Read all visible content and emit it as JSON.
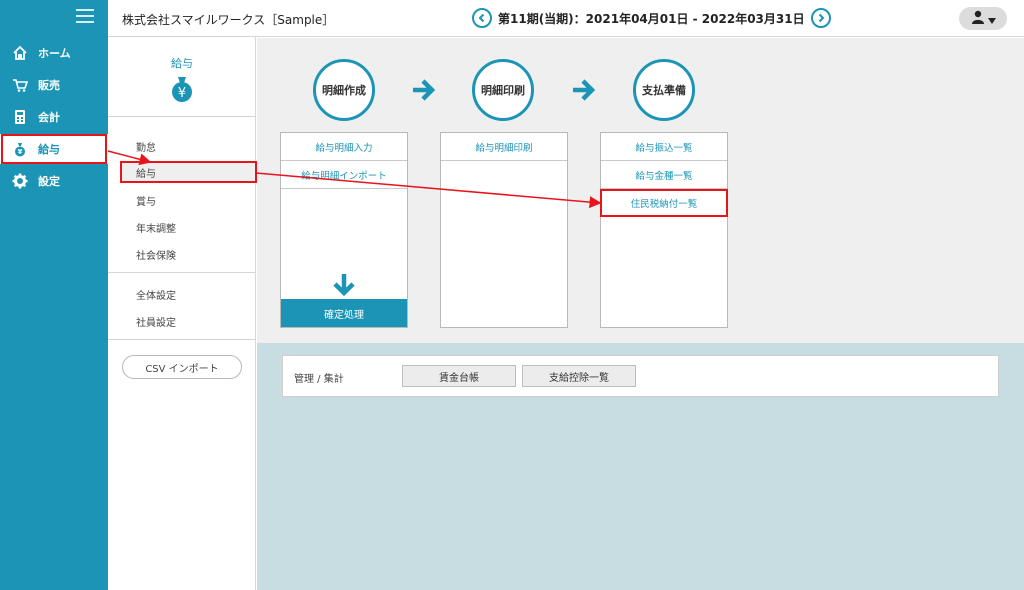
{
  "header": {
    "company": "株式会社スマイルワークス［Sample］",
    "period": "第11期(当期)：2021年04月01日 - 2022年03月31日"
  },
  "leftnav": {
    "items": [
      {
        "label": "ホーム",
        "icon": "home-icon"
      },
      {
        "label": "販売",
        "icon": "cart-icon"
      },
      {
        "label": "会計",
        "icon": "calculator-icon"
      },
      {
        "label": "給与",
        "icon": "money-bag-icon"
      },
      {
        "label": "設定",
        "icon": "gear-icon"
      }
    ]
  },
  "subnav": {
    "title": "給与",
    "group1": [
      "勤怠",
      "給与",
      "賞与",
      "年末調整",
      "社会保険"
    ],
    "group2": [
      "全体設定",
      "社員設定"
    ],
    "csv_button": "CSV インポート"
  },
  "steps": [
    {
      "label": "明細作成",
      "links": [
        "給与明細入力",
        "給与明細インポート"
      ],
      "confirm": "確定処理"
    },
    {
      "label": "明細印刷",
      "links": [
        "給与明細印刷"
      ]
    },
    {
      "label": "支払準備",
      "links": [
        "給与振込一覧",
        "給与金種一覧",
        "住民税納付一覧"
      ]
    }
  ],
  "summary": {
    "label": "管理 / 集計",
    "buttons": [
      "賃金台帳",
      "支給控除一覧"
    ]
  },
  "colors": {
    "accent": "#1b94b6",
    "highlight": "#e8141c",
    "bottom_bg": "#c7dde2"
  }
}
